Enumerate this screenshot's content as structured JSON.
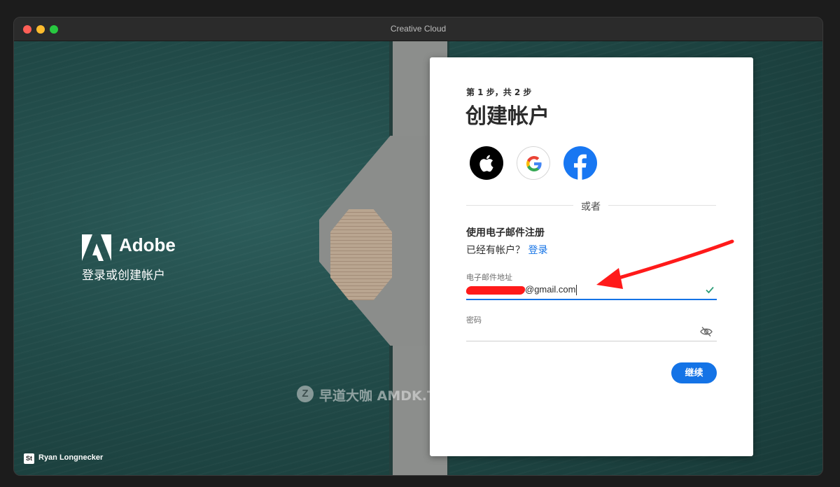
{
  "window": {
    "title": "Creative Cloud"
  },
  "brand": {
    "name": "Adobe",
    "subtitle": "登录或创建帐户"
  },
  "credit": {
    "badge": "St",
    "photographer": "Ryan Longnecker"
  },
  "watermark": {
    "letter": "Z",
    "text": "早道大咖 AMDK.TAOBAO.COM"
  },
  "form": {
    "step": "第 1 步，共 2 步",
    "heading": "创建帐户",
    "social": [
      {
        "icon": "apple-icon",
        "color": "#000000"
      },
      {
        "icon": "google-icon",
        "color": "#ffffff"
      },
      {
        "icon": "facebook-icon",
        "color": "#1877f2"
      }
    ],
    "divider_text": "或者",
    "email_signup_title": "使用电子邮件注册",
    "have_account_text": "已经有帐户？",
    "signin_link": "登录",
    "email_label": "电子邮件地址",
    "email_value": "@gmail.com",
    "password_label": "密码",
    "continue_label": "继续"
  },
  "colors": {
    "accent": "#1473e6",
    "annotation": "#ff1a1a"
  }
}
